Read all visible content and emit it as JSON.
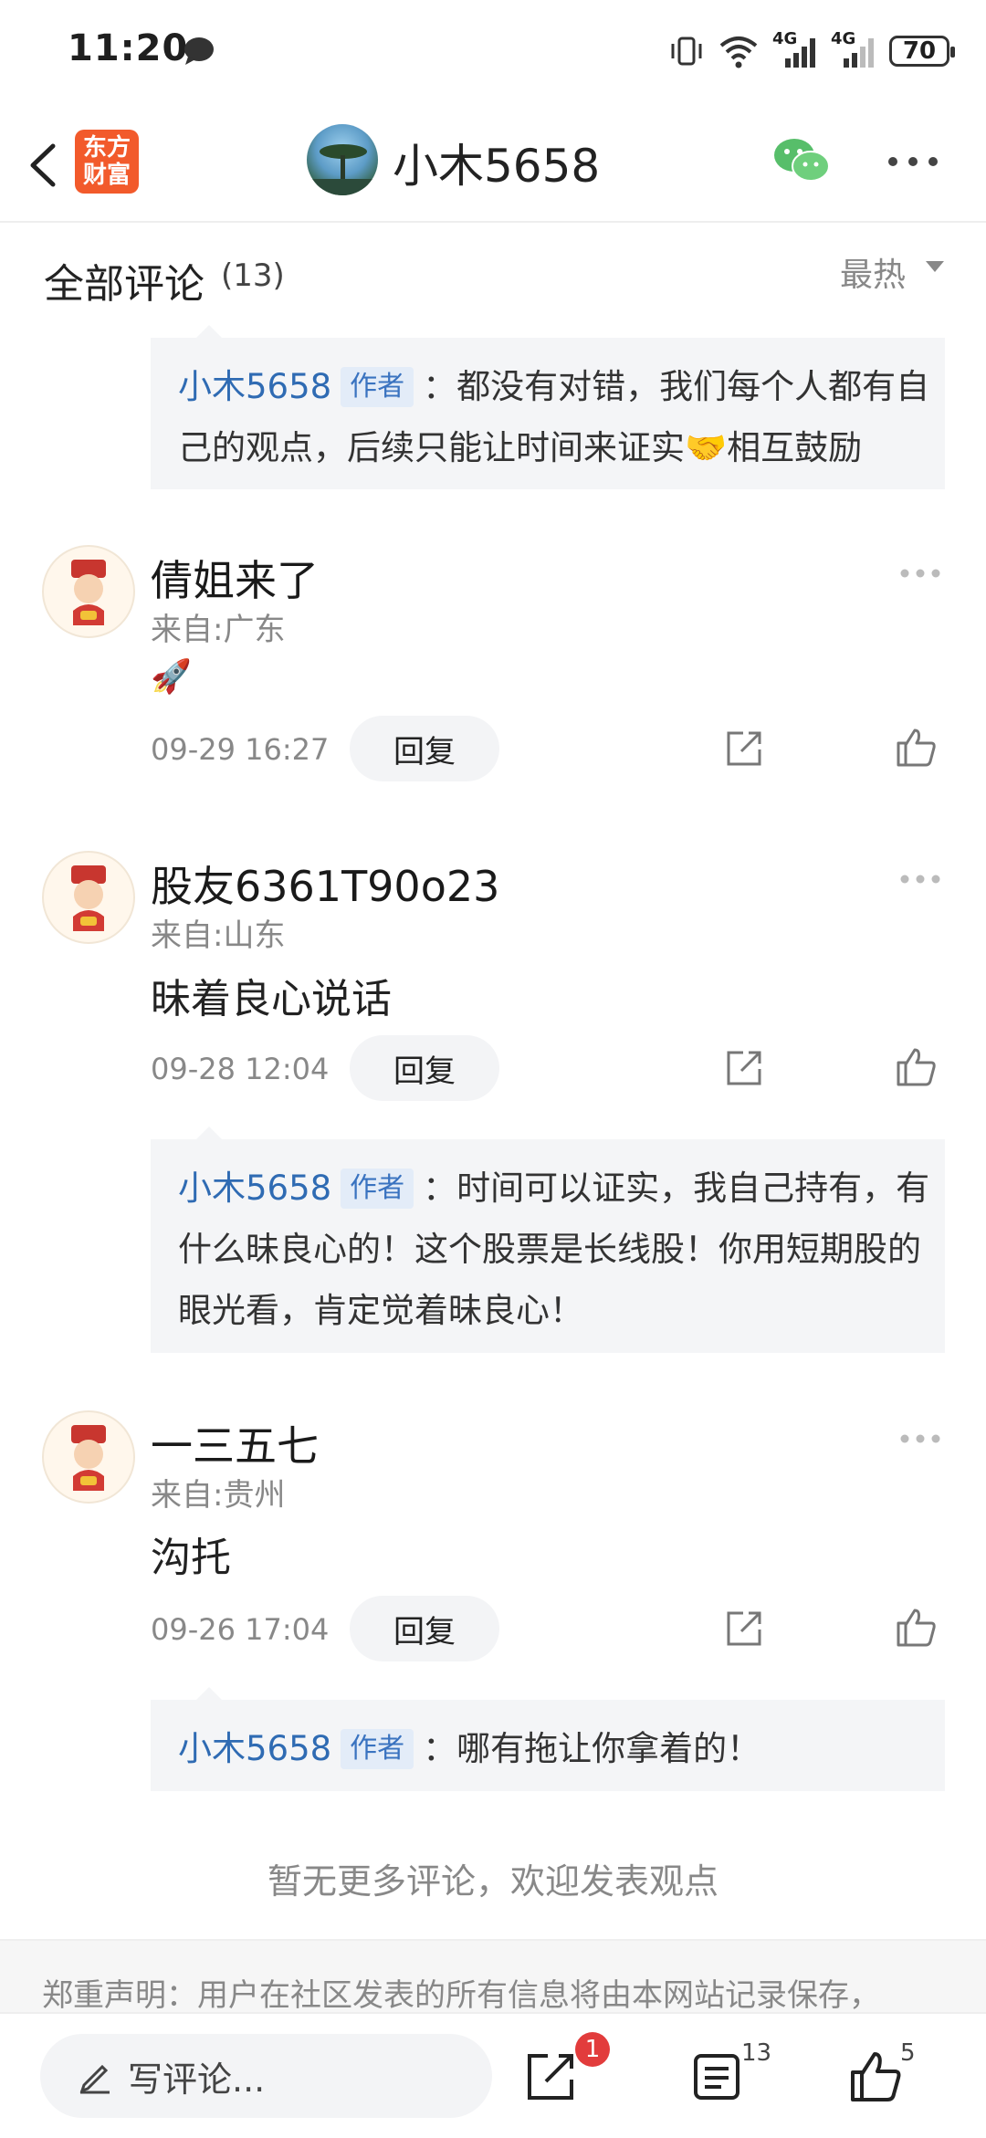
{
  "status_bar": {
    "time": "11:20",
    "battery": "70",
    "net1": "4G",
    "net2": "4G"
  },
  "nav": {
    "logo_line1": "东方",
    "logo_line2": "财富",
    "username": "小木5658"
  },
  "section": {
    "title": "全部评论",
    "count": "(13)",
    "sort": "最热"
  },
  "reply0": {
    "name": "小木5658",
    "badge": "作者",
    "text": "：都没有对错，我们每个人都有自己的观点，后续只能让时间来证实🤝相互鼓励"
  },
  "comments": [
    {
      "name": "倩姐来了",
      "location": "来自:广东",
      "text": "🚀",
      "time": "09-29 16:27",
      "reply_label": "回复"
    },
    {
      "name": "股友6361T90o23",
      "location": "来自:山东",
      "text": "昧着良心说话",
      "time": "09-28 12:04",
      "reply_label": "回复",
      "author_reply": {
        "name": "小木5658",
        "badge": "作者",
        "text": "：时间可以证实，我自己持有，有什么昧良心的！这个股票是长线股！你用短期股的眼光看，肯定觉着昧良心！"
      }
    },
    {
      "name": "一三五七",
      "location": "来自:贵州",
      "text": "沟托",
      "time": "09-26 17:04",
      "reply_label": "回复",
      "author_reply": {
        "name": "小木5658",
        "badge": "作者",
        "text": "：哪有拖让你拿着的！"
      }
    }
  ],
  "footer": {
    "no_more": "暂无更多评论，欢迎发表观点",
    "disclaimer": "郑重声明：用户在社区发表的所有信息将由本网站记录保存，"
  },
  "bottom_bar": {
    "write_placeholder": "写评论...",
    "share_badge": "1",
    "comment_count": "13",
    "like_count": "5"
  }
}
